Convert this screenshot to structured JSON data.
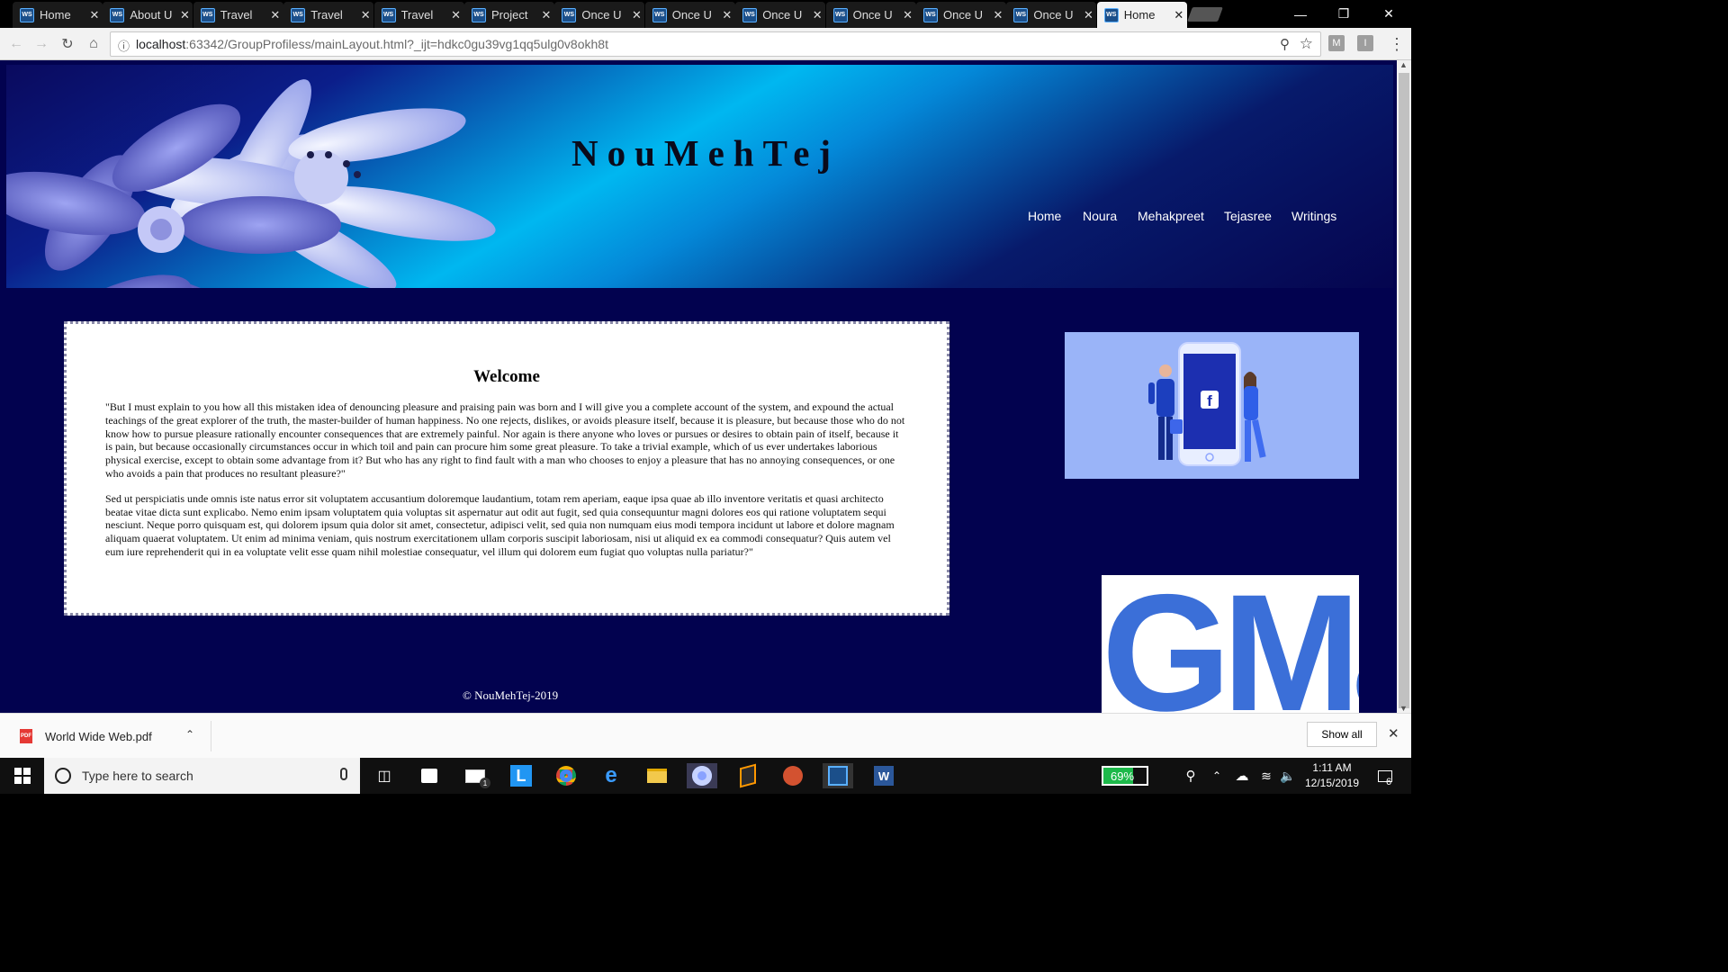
{
  "browser": {
    "tabs": [
      {
        "title": "Home"
      },
      {
        "title": "About U"
      },
      {
        "title": "Travel"
      },
      {
        "title": "Travel"
      },
      {
        "title": "Travel"
      },
      {
        "title": "Project"
      },
      {
        "title": "Once U"
      },
      {
        "title": "Once U"
      },
      {
        "title": "Once U"
      },
      {
        "title": "Once U"
      },
      {
        "title": "Once U"
      },
      {
        "title": "Once U"
      },
      {
        "title": "Home",
        "active": true
      }
    ],
    "tab_icon_text": "WS",
    "url_host": "localhost",
    "url_rest": ":63342/GroupProfiless/mainLayout.html?_ijt=hdkc0gu39vg1qq5ulg0v8okh8t",
    "extensions": [
      "M",
      "I"
    ]
  },
  "site": {
    "title": "NouMehTej",
    "nav": [
      "Home",
      "Noura",
      "Mehakpreet",
      "Tejasree",
      "Writings"
    ],
    "welcome_heading": "Welcome",
    "paragraph1": "\"But I must explain to you how all this mistaken idea of denouncing pleasure and praising pain was born and I will give you a complete account of the system, and expound the actual teachings of the great explorer of the truth, the master-builder of human happiness. No one rejects, dislikes, or avoids pleasure itself, because it is pleasure, but because those who do not know how to pursue pleasure rationally encounter consequences that are extremely painful. Nor again is there anyone who loves or pursues or desires to obtain pain of itself, because it is pain, but because occasionally circumstances occur in which toil and pain can procure him some great pleasure. To take a trivial example, which of us ever undertakes laborious physical exercise, except to obtain some advantage from it? But who has any right to find fault with a man who chooses to enjoy a pleasure that has no annoying consequences, or one who avoids a pain that produces no resultant pleasure?\"",
    "paragraph2": "Sed ut perspiciatis unde omnis iste natus error sit voluptatem accusantium doloremque laudantium, totam rem aperiam, eaque ipsa quae ab illo inventore veritatis et quasi architecto beatae vitae dicta sunt explicabo. Nemo enim ipsam voluptatem quia voluptas sit aspernatur aut odit aut fugit, sed quia consequuntur magni dolores eos qui ratione voluptatem sequi nesciunt. Neque porro quisquam est, qui dolorem ipsum quia dolor sit amet, consectetur, adipisci velit, sed quia non numquam eius modi tempora incidunt ut labore et dolore magnam aliquam quaerat voluptatem. Ut enim ad minima veniam, quis nostrum exercitationem ullam corporis suscipit laboriosam, nisi ut aliquid ex ea commodi consequatur? Quis autem vel eum iure reprehenderit qui in ea voluptate velit esse quam nihil molestiae consequatur, vel illum qui dolorem eum fugiat quo voluptas nulla pariatur?\"",
    "footer": "© NouMehTej-2019",
    "fb_letter": "f",
    "gmail_logo": "GMail"
  },
  "downloads": {
    "file_name": "World Wide Web.pdf",
    "file_badge": "PDF",
    "show_all": "Show all"
  },
  "taskbar": {
    "search_placeholder": "Type here to search",
    "mail_count": "1",
    "battery": "69%",
    "time": "1:11 AM",
    "date": "12/15/2019",
    "notifications": "6"
  },
  "colors": {
    "page_bg": "#02024f",
    "accent_cyan": "#00b7f0"
  }
}
